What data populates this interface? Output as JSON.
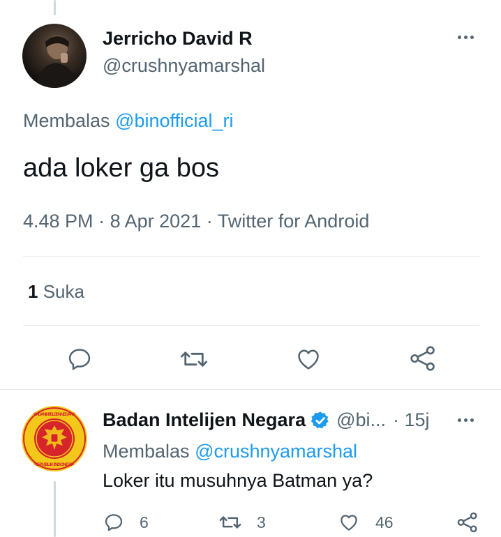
{
  "main_tweet": {
    "author_name": "Jerricho David R",
    "author_handle": "@crushnyamarshal",
    "reply_prefix": "Membalas",
    "reply_to": "@binofficial_ri",
    "text": "ada loker ga bos",
    "time": "4.48 PM",
    "separator": "·",
    "date": "8 Apr 2021",
    "source": "Twitter for Android",
    "likes_count": "1",
    "likes_label": "Suka",
    "icons": {
      "more": "more-icon",
      "reply": "reply-icon",
      "retweet": "retweet-icon",
      "like": "like-icon",
      "share": "share-icon"
    }
  },
  "reply_tweet": {
    "author_name": "Badan Intelijen Negara",
    "verified": true,
    "author_handle": "@bi...",
    "time": "· 15j",
    "reply_prefix": "Membalas",
    "reply_to": "@crushnyamarshal",
    "text": "Loker itu musuhnya Batman ya?",
    "reply_count": "6",
    "retweet_count": "3",
    "like_count": "46",
    "logo_text_top": "BADAN INTELIJEN NEGARA",
    "logo_text_bottom": "REPUBLIK INDONESIA"
  },
  "colors": {
    "accent": "#1d9bf0",
    "text": "#0f1419",
    "muted": "#536471",
    "divider": "#e7ebee",
    "logo_red": "#d6242a",
    "logo_gold": "#f3c81a"
  }
}
